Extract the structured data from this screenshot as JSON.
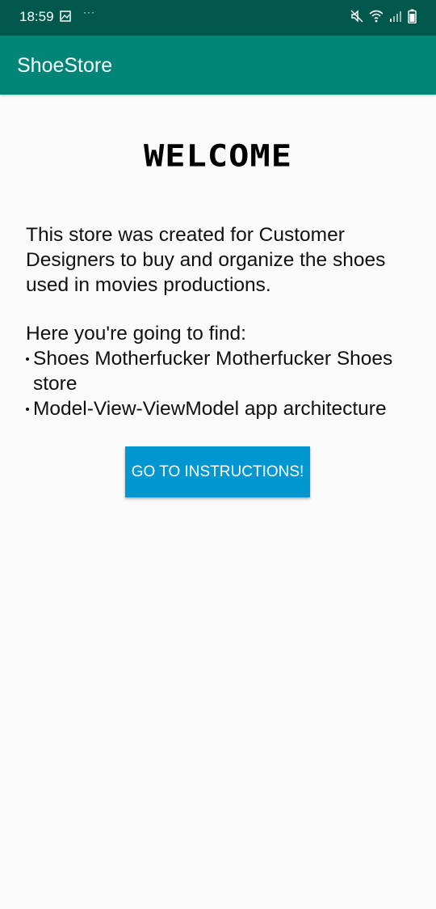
{
  "status_bar": {
    "time": "18:59",
    "dots": "···",
    "icons": [
      "gallery-icon",
      "mute-icon",
      "wifi-icon",
      "signal-icon",
      "battery-icon"
    ],
    "color": "#00574b"
  },
  "app_bar": {
    "title": "ShoeStore",
    "color": "#008577"
  },
  "welcome": {
    "title": "WELCOME",
    "intro": "This store was created for Customer Designers to buy and organize the shoes used in movies productions.",
    "find_heading": "Here you're going to find:",
    "bullets": [
      "Shoes Motherfucker Motherfucker Shoes store",
      "Model-View-ViewModel app architecture"
    ]
  },
  "instructions_button": {
    "label": "GO TO INSTRUCTIONS!",
    "color": "#0397d1"
  }
}
